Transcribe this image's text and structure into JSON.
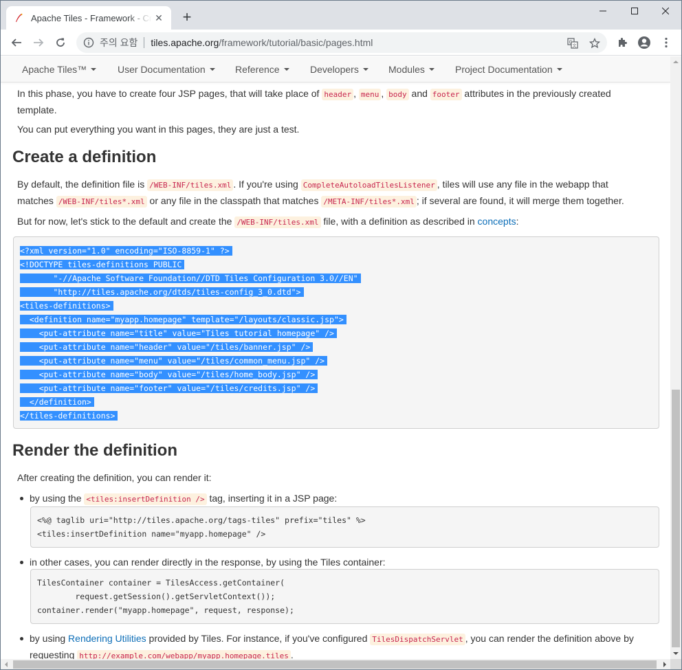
{
  "browser": {
    "tab_title": "Apache Tiles - Framework - Creating a definition",
    "tab_close": "✕",
    "new_tab": "+",
    "security_label": "주의 요함",
    "url_host": "tiles.apache.org",
    "url_path": "/framework/tutorial/basic/pages.html"
  },
  "nav": {
    "items": [
      {
        "label": "Apache Tiles™"
      },
      {
        "label": "User Documentation"
      },
      {
        "label": "Reference"
      },
      {
        "label": "Developers"
      },
      {
        "label": "Modules"
      },
      {
        "label": "Project Documentation"
      }
    ]
  },
  "content": {
    "intro": {
      "t1": "In this phase, you have to create four JSP pages, that will take place of ",
      "c_header": "header",
      "sep1": ", ",
      "c_menu": "menu",
      "sep2": ", ",
      "c_body": "body",
      "and": " and ",
      "c_footer": "footer",
      "t2": " attributes in the previously created",
      "t3": "template."
    },
    "intro2": "You can put everything you want in this pages, they are just a test.",
    "h_create": "Create a definition",
    "def": {
      "t1": "By default, the definition file is ",
      "c1": "/WEB-INF/tiles.xml",
      "t2": ". If you're using ",
      "c2": "CompleteAutoloadTilesListener",
      "t3": ", tiles will use any file in the webapp that",
      "t4": "matches ",
      "c3": "/WEB-INF/tiles*.xml",
      "t5": " or any file in the classpath that matches ",
      "c4": "/META-INF/tiles*.xml",
      "t6": "; if several are found, it will merge them together."
    },
    "def2": {
      "t1": "But for now, let's stick to the default and create the ",
      "c1": "/WEB-INF/tiles.xml",
      "t2": " file, with a definition as described in ",
      "link": "concepts",
      "t3": ":"
    },
    "xml_lines": [
      "<?xml version=\"1.0\" encoding=\"ISO-8859-1\" ?>",
      "<!DOCTYPE tiles-definitions PUBLIC",
      "       \"-//Apache Software Foundation//DTD Tiles Configuration 3.0//EN\"",
      "       \"http://tiles.apache.org/dtds/tiles-config_3_0.dtd\">",
      "<tiles-definitions>",
      "  <definition name=\"myapp.homepage\" template=\"/layouts/classic.jsp\">",
      "    <put-attribute name=\"title\" value=\"Tiles tutorial homepage\" />",
      "    <put-attribute name=\"header\" value=\"/tiles/banner.jsp\" />",
      "    <put-attribute name=\"menu\" value=\"/tiles/common_menu.jsp\" />",
      "    <put-attribute name=\"body\" value=\"/tiles/home_body.jsp\" />",
      "    <put-attribute name=\"footer\" value=\"/tiles/credits.jsp\" />",
      "  </definition>",
      "</tiles-definitions>"
    ],
    "h_render": "Render the definition",
    "render_intro": "After creating the definition, you can render it:",
    "b1": {
      "t1": "by using the ",
      "c1": "<tiles:insertDefinition />",
      "t2": " tag, inserting it in a JSP page:"
    },
    "jsp_lines": [
      "<%@ taglib uri=\"http://tiles.apache.org/tags-tiles\" prefix=\"tiles\" %>",
      "<tiles:insertDefinition name=\"myapp.homepage\" />"
    ],
    "b2": "in other cases, you can render directly in the response, by using the Tiles container:",
    "java_lines": [
      "TilesContainer container = TilesAccess.getContainer(",
      "        request.getSession().getServletContext());",
      "container.render(\"myapp.homepage\", request, response);"
    ],
    "b3": {
      "t1": "by using ",
      "link": "Rendering Utilities",
      "t2": " provided by Tiles. For instance, if you've configured ",
      "c1": "TilesDispatchServlet",
      "t3": ", you can render the definition above by",
      "t4": "requesting ",
      "c2": "http://example.com/webapp/myapp.homepage.tiles",
      "t5": "."
    }
  }
}
